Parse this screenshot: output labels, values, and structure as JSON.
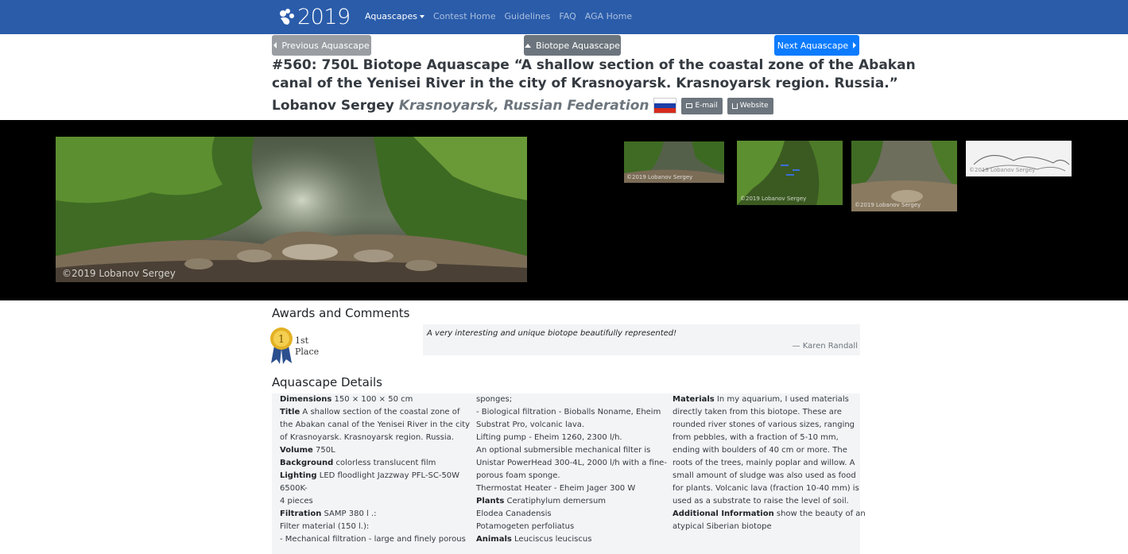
{
  "nav": {
    "year": "2019",
    "links": [
      {
        "label": "Aquascapes",
        "active": true,
        "dropdown": true
      },
      {
        "label": "Contest Home",
        "active": false
      },
      {
        "label": "Guidelines",
        "active": false
      },
      {
        "label": "FAQ",
        "active": false
      },
      {
        "label": "AGA Home",
        "active": false
      }
    ],
    "color": "#2a5caa"
  },
  "pager": {
    "prev": "Previous Aquascape",
    "category": "Biotope Aquascape",
    "next": "Next Aquascape"
  },
  "entry": {
    "title_line1": "#560: 750L Biotope Aquascape “A shallow section of the coastal zone of the Abakan",
    "title_line2": "canal of the Yenisei River in the city of Krasnoyarsk. Krasnoyarsk region. Russia.”",
    "author": "Lobanov Sergey",
    "location": "Krasnoyarsk, Russian Federation",
    "email_label": "E-mail",
    "website_label": "Website"
  },
  "gallery": {
    "main_watermark": "©2019 Lobanov Sergey",
    "thumb_watermarks": [
      "©2019 Lobanov Sergey",
      "©2019 Lobanov Sergey",
      "©2019 Lobanov Sergey",
      "©2019 Lobanov Sergey"
    ]
  },
  "awards": {
    "heading": "Awards and Comments",
    "place_line1": "1st",
    "place_line2": "Place",
    "comment": "A very interesting and unique biotope beautifully represented!",
    "by": "— Karen Randall"
  },
  "details": {
    "heading": "Aquascape Details",
    "col1": [
      {
        "k": "Dimensions",
        "v": " 150 × 100 × 50 cm"
      },
      {
        "k": "Title",
        "v": " A shallow section of the coastal zone of"
      },
      {
        "k": "",
        "v": "the Abakan canal of the Yenisei River in the city"
      },
      {
        "k": "",
        "v": "of Krasnoyarsk. Krasnoyarsk region. Russia."
      },
      {
        "k": "Volume",
        "v": " 750L"
      },
      {
        "k": "Background",
        "v": " colorless translucent film"
      },
      {
        "k": "Lighting",
        "v": " LED floodlight Jazzway PFL-SC-50W"
      },
      {
        "k": "",
        "v": "6500K-"
      },
      {
        "k": "",
        "v": "4 pieces"
      },
      {
        "k": "Filtration",
        "v": " SAMP 380 l .:"
      },
      {
        "k": "",
        "v": "Filter material (150 l.):"
      },
      {
        "k": "",
        "v": "- Mechanical filtration - large and finely porous"
      }
    ],
    "col2": [
      {
        "k": "",
        "v": "sponges;"
      },
      {
        "k": "",
        "v": "- Biological filtration - Bioballs Noname, Eheim"
      },
      {
        "k": "",
        "v": "Substrat Pro, volcanic lava."
      },
      {
        "k": "",
        "v": "Lifting pump - Eheim 1260, 2300 l/h."
      },
      {
        "k": "",
        "v": "An optional submersible mechanical filter is"
      },
      {
        "k": "",
        "v": "Unistar PowerHead 300-4L, 2000 l/h with a fine-"
      },
      {
        "k": "",
        "v": "porous foam sponge."
      },
      {
        "k": "",
        "v": "Thermostat Heater - Eheim Jager 300 W"
      },
      {
        "k": "Plants",
        "v": " Ceratiphylum demersum"
      },
      {
        "k": "",
        "v": "Elodea Canadensis"
      },
      {
        "k": "",
        "v": "Potamogeten perfoliatus"
      },
      {
        "k": "Animals",
        "v": " Leuciscus leuciscus"
      }
    ],
    "col3": [
      {
        "k": "Materials",
        "v": " In my aquarium, I used materials"
      },
      {
        "k": "",
        "v": "directly taken from this biotope. These are"
      },
      {
        "k": "",
        "v": "rounded river stones of various sizes, ranging"
      },
      {
        "k": "",
        "v": "from pebbles, with a fraction of 5-10 mm,"
      },
      {
        "k": "",
        "v": "ending with boulders of 40 cm or more. The"
      },
      {
        "k": "",
        "v": "roots of the trees, mainly poplar and willow. A"
      },
      {
        "k": "",
        "v": "small amount of sludge was also used as food"
      },
      {
        "k": "",
        "v": "for plants. Volcanic lava (fraction 10-40 mm) is"
      },
      {
        "k": "",
        "v": "used as a substrate to raise the level of soil."
      },
      {
        "k": "Additional Information",
        "v": " show the beauty of an"
      },
      {
        "k": "",
        "v": "atypical Siberian biotope"
      }
    ]
  }
}
